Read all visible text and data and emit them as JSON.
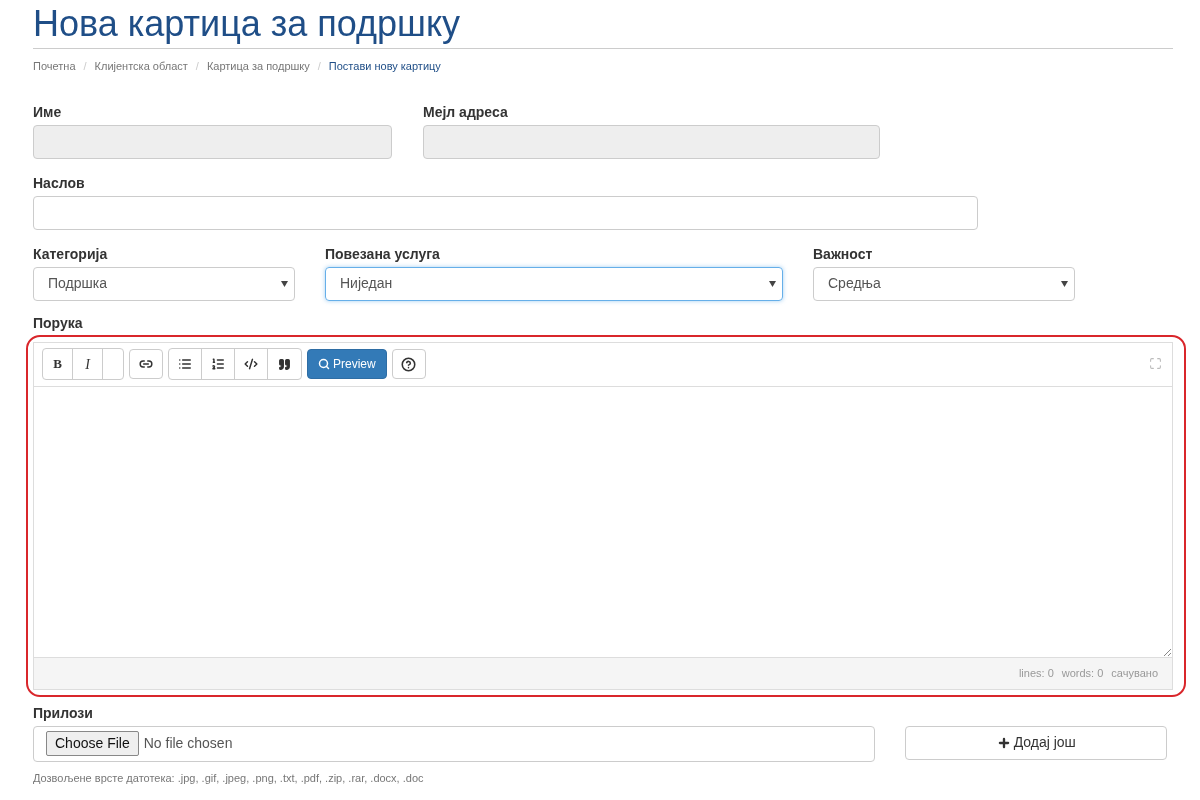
{
  "title": "Нова картица за подршку",
  "breadcrumb_separator": "/",
  "breadcrumb": [
    {
      "label": "Почетна",
      "active": false
    },
    {
      "label": "Клијентска област",
      "active": false
    },
    {
      "label": "Картица за подршку",
      "active": false
    },
    {
      "label": "Постави нову картицу",
      "active": true
    }
  ],
  "name_field": {
    "label": "Име",
    "disabled": true
  },
  "email_field": {
    "label": "Мејл адреса",
    "disabled": true
  },
  "subject_field": {
    "label": "Наслов",
    "disabled": false
  },
  "selects": [
    {
      "label": "Категорија",
      "value": "Подршка",
      "focused": false
    },
    {
      "label": "Повезана услуга",
      "value": "Ниједан",
      "focused": true
    },
    {
      "label": "Важност",
      "value": "Средња",
      "focused": false
    }
  ],
  "message": {
    "label": "Порука",
    "highlighted": true,
    "toolbar_groups": [
      [
        {
          "kind": "bold",
          "label": "B"
        },
        {
          "kind": "italic",
          "label": "I"
        },
        {
          "kind": "blank"
        }
      ],
      [
        {
          "kind": "link"
        }
      ],
      [
        {
          "kind": "bullet-list"
        },
        {
          "kind": "numbered-list"
        },
        {
          "kind": "code"
        },
        {
          "kind": "quote"
        }
      ],
      [
        {
          "kind": "preview",
          "label": "Preview"
        }
      ],
      [
        {
          "kind": "help"
        }
      ]
    ],
    "status": [
      "lines: 0",
      "words: 0",
      "сачувано"
    ]
  },
  "attachments": {
    "label": "Прилози",
    "choose_button": "Choose File",
    "file_status": "No file chosen",
    "add_button": "Додај још",
    "help": "Дозвољене врсте датотека: .jpg, .gif, .jpeg, .png, .txt, .pdf, .zip, .rar, .docx, .doc"
  }
}
